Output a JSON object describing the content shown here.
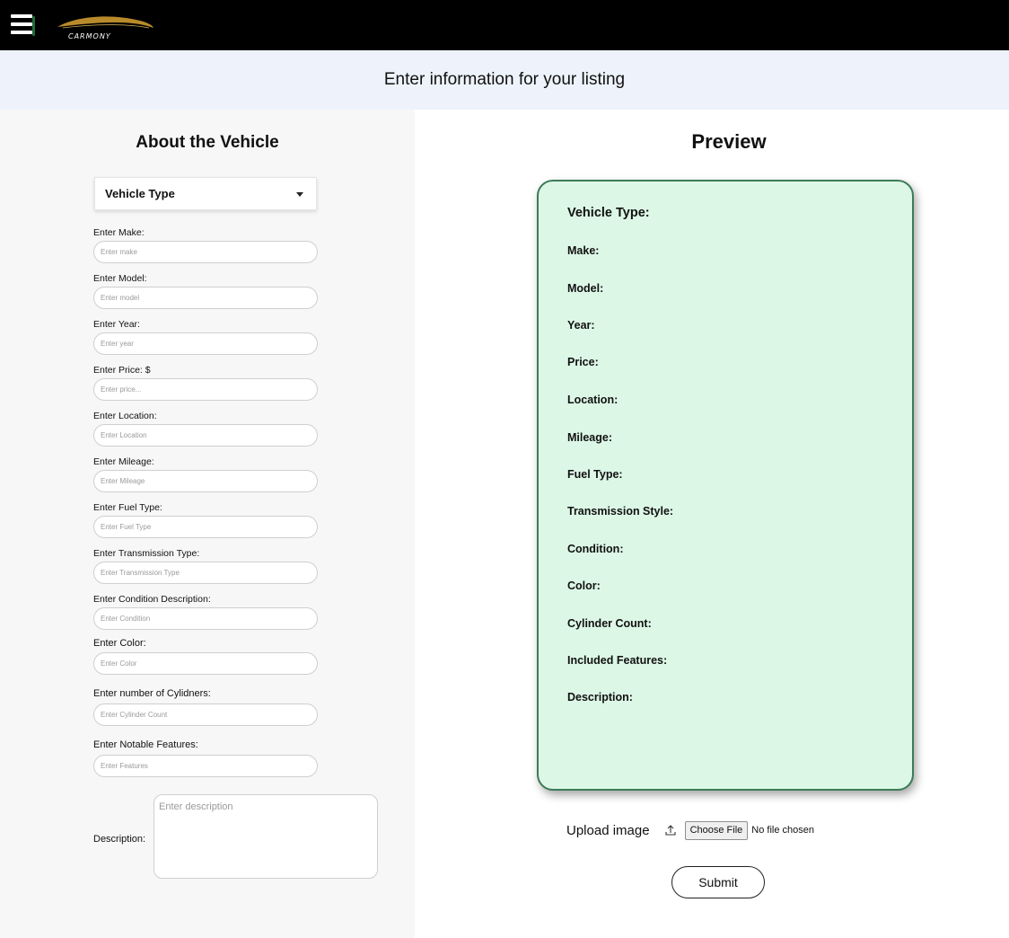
{
  "page": {
    "heading": "Enter information for your listing"
  },
  "nav": {
    "logo_text": "CARMONY"
  },
  "form": {
    "title": "About the Vehicle",
    "vehicle_type_label": "Vehicle Type",
    "fields": [
      {
        "label": "Enter Make:",
        "placeholder": "Enter make"
      },
      {
        "label": "Enter Model:",
        "placeholder": "Enter model"
      },
      {
        "label": "Enter Year:",
        "placeholder": "Enter year"
      },
      {
        "label": "Enter Price: $",
        "placeholder": "Enter price..."
      },
      {
        "label": "Enter Location:",
        "placeholder": "Enter Location"
      },
      {
        "label": "Enter Mileage:",
        "placeholder": "Enter Mileage"
      },
      {
        "label": "Enter Fuel Type:",
        "placeholder": "Enter Fuel Type"
      },
      {
        "label": "Enter Transmission Type:",
        "placeholder": "Enter Transmission Type"
      },
      {
        "label": "Enter Condition Description:",
        "placeholder": "Enter Condition"
      },
      {
        "label": "Enter Color:",
        "placeholder": "Enter Color"
      },
      {
        "label": "Enter number of Cylidners:",
        "placeholder": "Enter Cylinder Count"
      },
      {
        "label": "Enter Notable Features:",
        "placeholder": "Enter Features"
      }
    ],
    "description_label": "Description:",
    "description_placeholder": "Enter description"
  },
  "preview": {
    "title": "Preview",
    "rows": [
      "Vehicle Type:",
      "Make:",
      "Model:",
      "Year:",
      "Price:",
      "Location:",
      "Mileage:",
      "Fuel Type:",
      "Transmission Style:",
      "Condition:",
      "Color:",
      "Cylinder Count:",
      "Included Features:",
      "Description:"
    ]
  },
  "upload": {
    "label": "Upload image",
    "icon": "upload-icon",
    "choose_button": "Choose File",
    "status": "No file chosen"
  },
  "submit_label": "Submit"
}
